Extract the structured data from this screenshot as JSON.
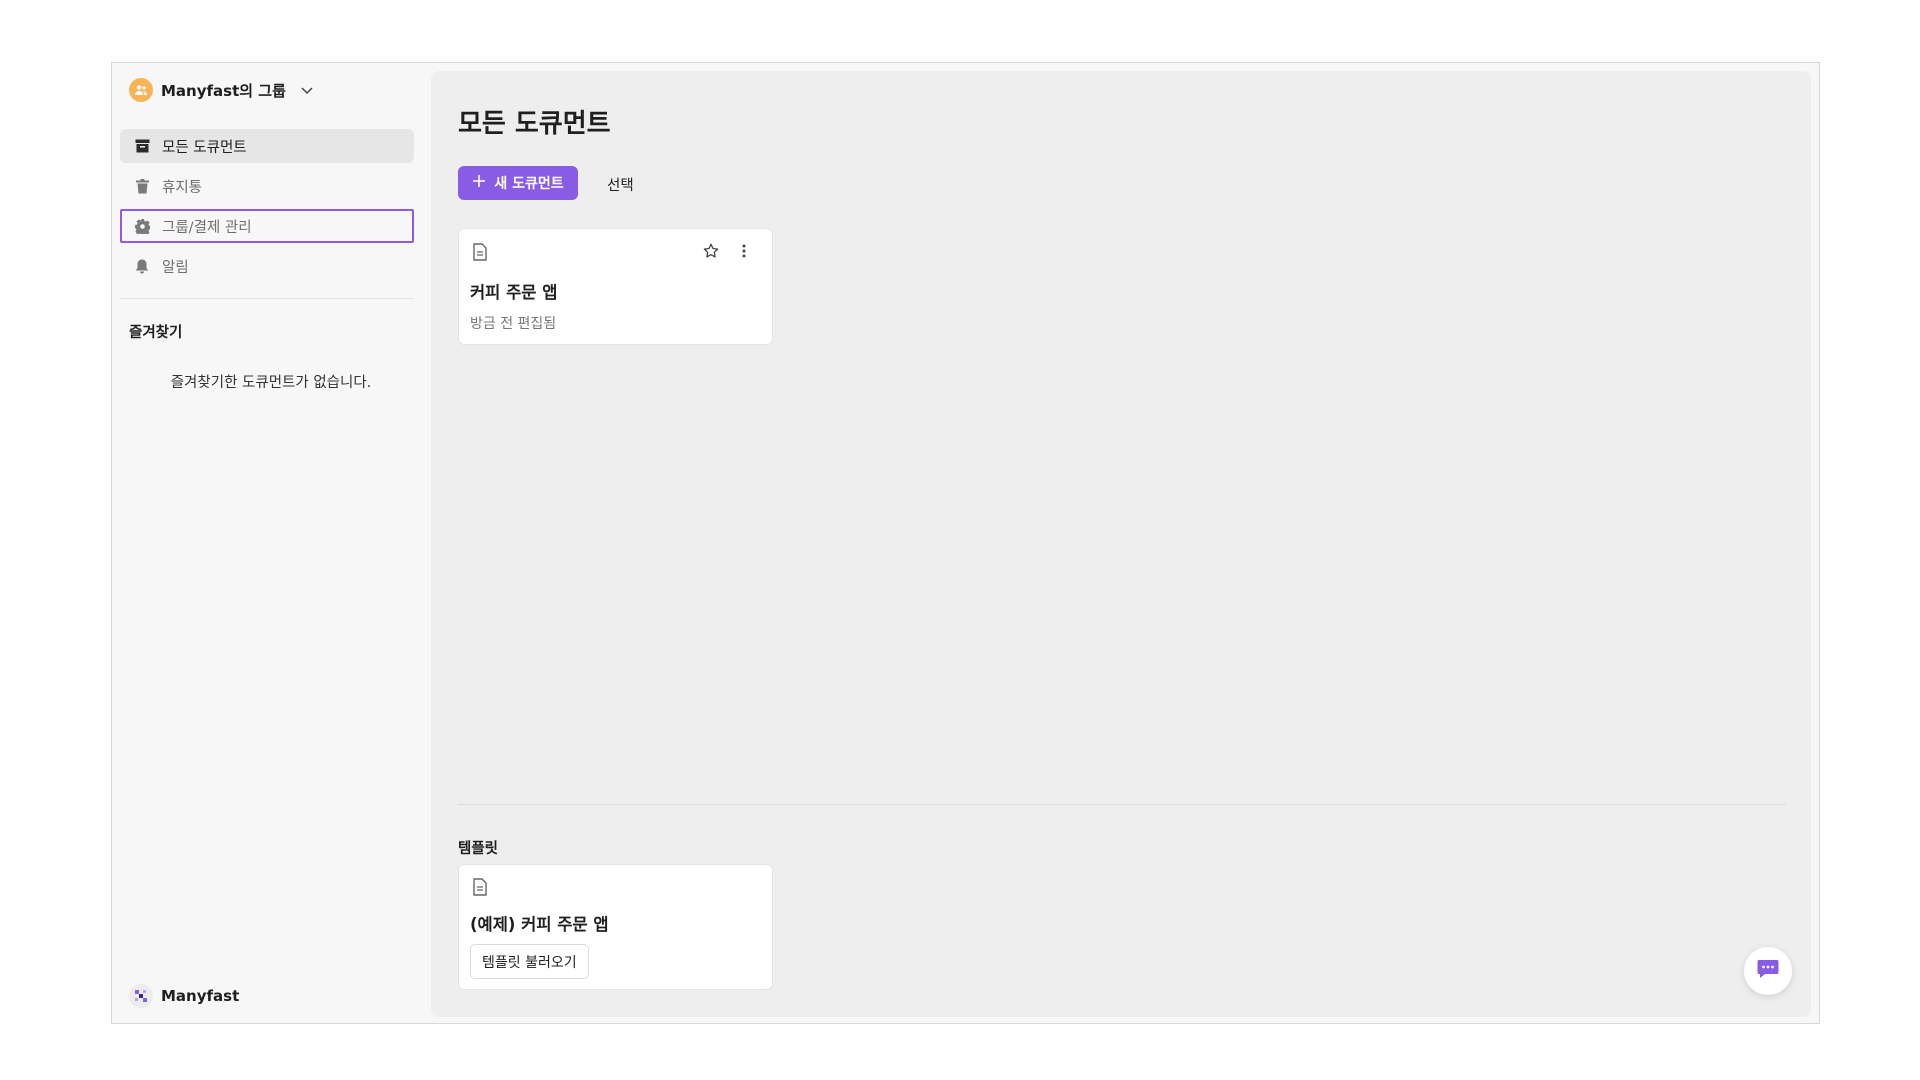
{
  "colors": {
    "accent": "#8a5ce6",
    "group_avatar": "#f5b455"
  },
  "sidebar": {
    "group_name": "Manyfast의 그룹",
    "items": [
      {
        "label": "모든 도큐먼트",
        "icon": "archive-icon",
        "active": true
      },
      {
        "label": "휴지통",
        "icon": "trash-icon"
      },
      {
        "label": "그룹/결제 관리",
        "icon": "gear-icon",
        "focused": true
      },
      {
        "label": "알림",
        "icon": "bell-icon"
      }
    ],
    "favorites_title": "즐겨찾기",
    "favorites_empty": "즐겨찾기한 도큐먼트가 없습니다.",
    "brand": "Manyfast"
  },
  "main": {
    "title": "모든 도큐먼트",
    "new_doc_label": "새 도큐먼트",
    "select_label": "선택",
    "documents": [
      {
        "title": "커피 주문 앱",
        "meta": "방금 전 편집됨"
      }
    ],
    "templates_title": "템플릿",
    "templates": [
      {
        "title": "(예제) 커피 주문 앱",
        "button": "템플릿 불러오기"
      }
    ]
  }
}
